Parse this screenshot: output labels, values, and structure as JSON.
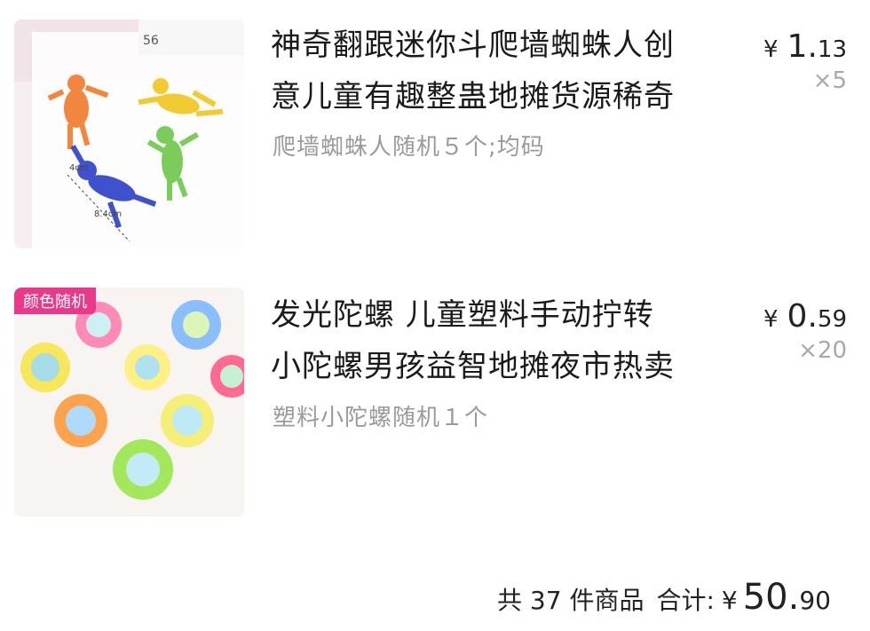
{
  "items": [
    {
      "title_line1": "神奇翻跟迷你斗爬墙蜘蛛人创",
      "title_line2": "意儿童有趣整蛊地摊货源稀奇",
      "sku": "爬墙蜘蛛人随机５个;均码",
      "price_symbol": "¥",
      "price_int": "1.",
      "price_dec": "13",
      "qty": "×5",
      "image_icon": "wall-climbing-toy-image"
    },
    {
      "title_line1": "发光陀螺 儿童塑料手动拧转",
      "title_line2": "小陀螺男孩益智地摊夜市热卖",
      "sku": "塑料小陀螺随机１个",
      "price_symbol": "¥",
      "price_int": "0.",
      "price_dec": "59",
      "qty": "×20",
      "image_badge": "颜色随机",
      "image_icon": "spinning-top-toy-image"
    }
  ],
  "summary": {
    "count_text": "共 37 件商品",
    "total_label": "合计:",
    "total_symbol": "¥",
    "total_int": "50.",
    "total_dec": "90"
  },
  "colors": {
    "badge": "#e8398a",
    "sku_text": "#9a9a9a"
  }
}
